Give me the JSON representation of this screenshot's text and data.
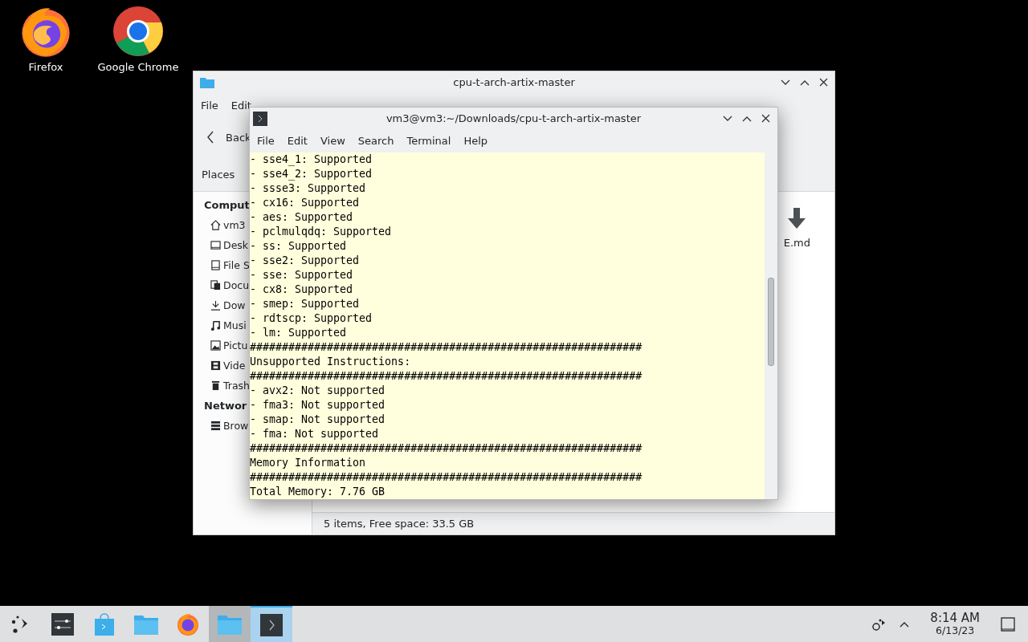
{
  "desktop_icons": [
    {
      "kind": "firefox",
      "label": "Firefox"
    },
    {
      "kind": "chrome",
      "label": "Google Chrome"
    }
  ],
  "file_manager": {
    "title": "cpu-t-arch-artix-master",
    "menu": [
      "File",
      "Edit"
    ],
    "back": "Back",
    "places": "Places",
    "sidebar": [
      {
        "kind": "heading",
        "label": "Comput"
      },
      {
        "kind": "home",
        "label": "vm3"
      },
      {
        "kind": "desktop",
        "label": "Desk"
      },
      {
        "kind": "drive",
        "label": "File S"
      },
      {
        "kind": "documents",
        "label": "Docu"
      },
      {
        "kind": "downloads",
        "label": "Dow"
      },
      {
        "kind": "music",
        "label": "Musi"
      },
      {
        "kind": "pictures",
        "label": "Pictu"
      },
      {
        "kind": "videos",
        "label": "Vide"
      },
      {
        "kind": "trash",
        "label": "Trash"
      },
      {
        "kind": "heading",
        "label": "Networ"
      },
      {
        "kind": "network",
        "label": "Brow"
      }
    ],
    "files": [
      {
        "label": "E.md"
      }
    ],
    "status_bar": "5 items, Free space: 33.5 GB"
  },
  "terminal": {
    "title": "vm3@vm3:~/Downloads/cpu-t-arch-artix-master",
    "menu": [
      "File",
      "Edit",
      "View",
      "Search",
      "Terminal",
      "Help"
    ],
    "lines": [
      "- sse4_1: Supported",
      "- sse4_2: Supported",
      "- ssse3: Supported",
      "- cx16: Supported",
      "- aes: Supported",
      "- pclmulqdq: Supported",
      "- ss: Supported",
      "- sse2: Supported",
      "- sse: Supported",
      "- cx8: Supported",
      "- smep: Supported",
      "- rdtscp: Supported",
      "- lm: Supported",
      "#############################################################",
      "Unsupported Instructions:",
      "#############################################################",
      "- avx2: Not supported",
      "- fma3: Not supported",
      "- smap: Not supported",
      "- fma: Not supported",
      "#############################################################",
      "Memory Information",
      "#############################################################",
      "Total Memory: 7.76 GB"
    ]
  },
  "taskbar": {
    "items": [
      {
        "kind": "launcher",
        "open": false,
        "selected": false
      },
      {
        "kind": "settings",
        "open": false,
        "selected": false
      },
      {
        "kind": "store",
        "open": false,
        "selected": false
      },
      {
        "kind": "folder",
        "open": false,
        "selected": false
      },
      {
        "kind": "firefox",
        "open": false,
        "selected": false
      },
      {
        "kind": "folder",
        "open": true,
        "selected": false
      },
      {
        "kind": "terminal",
        "open": true,
        "selected": true
      }
    ],
    "time": "8:14 AM",
    "date": "6/13/23"
  }
}
